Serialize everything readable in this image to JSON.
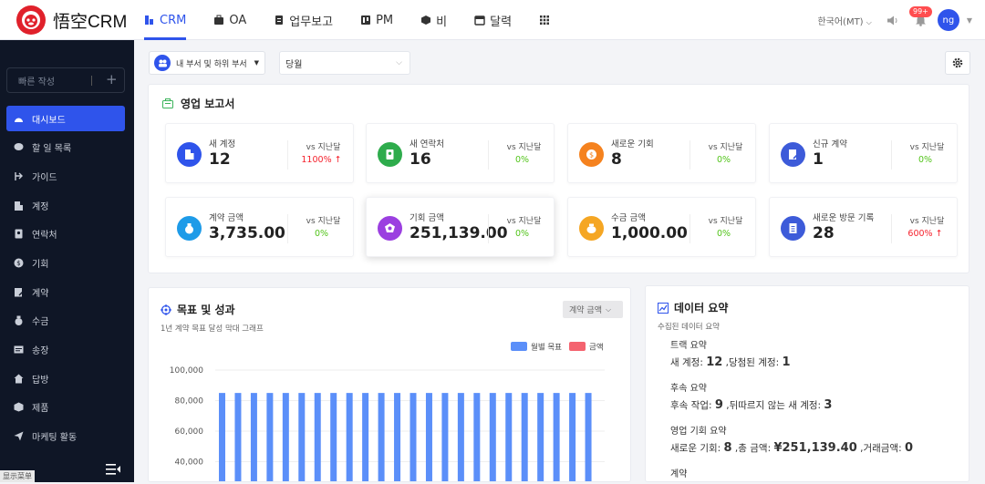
{
  "brand": {
    "name": "悟空CRM"
  },
  "nav": {
    "items": [
      {
        "label": "CRM",
        "icon": "chart-icon",
        "active": true
      },
      {
        "label": "OA",
        "icon": "briefcase-icon"
      },
      {
        "label": "업무보고",
        "icon": "report-icon"
      },
      {
        "label": "PM",
        "icon": "kanban-icon"
      },
      {
        "label": "비",
        "icon": "cube-icon"
      },
      {
        "label": "달력",
        "icon": "calendar-icon"
      }
    ],
    "language": "한국어(MT)",
    "notification_badge": "99+",
    "user_initials": "ng"
  },
  "sidebar": {
    "quick_create": "빠른 작성",
    "items": [
      {
        "label": "대시보드",
        "icon": "dashboard-icon",
        "active": true
      },
      {
        "label": "할 일 목록",
        "icon": "chat-icon"
      },
      {
        "label": "가이드",
        "icon": "guide-icon"
      },
      {
        "label": "계정",
        "icon": "building-icon"
      },
      {
        "label": "연락처",
        "icon": "contact-icon"
      },
      {
        "label": "기회",
        "icon": "coin-icon"
      },
      {
        "label": "계약",
        "icon": "contract-icon"
      },
      {
        "label": "수금",
        "icon": "moneybag-icon"
      },
      {
        "label": "송장",
        "icon": "invoice-icon"
      },
      {
        "label": "답방",
        "icon": "home-icon"
      },
      {
        "label": "제품",
        "icon": "box-icon"
      },
      {
        "label": "마케팅 활동",
        "icon": "send-icon"
      }
    ],
    "footer_tag": "显示菜单"
  },
  "filters": {
    "department": "내 부서 및 하위 부서",
    "period": "당월"
  },
  "sales_report": {
    "title": "영업 보고서",
    "compare_label": "vs 지난달",
    "stats": [
      {
        "label": "새 계정",
        "value": "12",
        "change": "1100%",
        "trend": "up",
        "color": "#2f54eb",
        "icon": "building-icon"
      },
      {
        "label": "새 연락처",
        "value": "16",
        "change": "0%",
        "trend": "flat",
        "color": "#2eac4c",
        "icon": "contact-icon"
      },
      {
        "label": "새로운 기회",
        "value": "8",
        "change": "0%",
        "trend": "flat",
        "color": "#f5821f",
        "icon": "coin-icon"
      },
      {
        "label": "신규 계약",
        "value": "1",
        "change": "0%",
        "trend": "flat",
        "color": "#3d5bd9",
        "icon": "contract-icon"
      },
      {
        "label": "계약 금액",
        "value": "3,735.00",
        "change": "0%",
        "trend": "flat",
        "color": "#1e9be8",
        "icon": "moneybag-icon"
      },
      {
        "label": "기회 금액",
        "value": "251,139.00",
        "change": "0%",
        "trend": "flat",
        "color": "#9b3fe0",
        "icon": "gem-icon"
      },
      {
        "label": "수금 금액",
        "value": "1,000.00",
        "change": "0%",
        "trend": "flat",
        "color": "#f5a623",
        "icon": "wallet-icon"
      },
      {
        "label": "새로운 방문 기록",
        "value": "28",
        "change": "600%",
        "trend": "up",
        "color": "#3d5bd9",
        "icon": "record-icon"
      }
    ]
  },
  "goals": {
    "title": "목표 및 성과",
    "subtitle": "1년 계약 목표 달성 막대 그래프",
    "selector": "계약 금액"
  },
  "chart_data": {
    "type": "bar",
    "series": [
      {
        "name": "월별 목표",
        "color": "#5b8ff9",
        "values": [
          85000,
          85000,
          85000,
          85000,
          85000,
          85000,
          85000,
          85000,
          85000,
          85000,
          85000,
          85000,
          85000,
          85000,
          85000,
          85000,
          85000,
          85000,
          85000,
          85000,
          85000,
          85000,
          85000,
          85000
        ]
      },
      {
        "name": "금액",
        "color": "#f4636f",
        "values": []
      }
    ],
    "y_ticks": [
      "100,000",
      "80,000",
      "60,000",
      "40,000"
    ],
    "ylim": [
      20000,
      100000
    ]
  },
  "data_summary": {
    "title": "데이터 요약",
    "subtitle": "수집된 데이터 요약",
    "blocks": [
      {
        "title": "트랙 요약",
        "parts": [
          {
            "label": "새 계정:",
            "value": "12"
          },
          {
            "label": ",당첨된 계정:",
            "value": "1"
          }
        ]
      },
      {
        "title": "후속 요약",
        "parts": [
          {
            "label": "후속 작업:",
            "value": "9"
          },
          {
            "label": ",뒤따르지 않는 새 계정:",
            "value": "3"
          }
        ]
      },
      {
        "title": "영업 기회 요약",
        "parts": [
          {
            "label": "새로운 기회:",
            "value": "8"
          },
          {
            "label": ",총 금액:",
            "value": "¥251,139.40"
          },
          {
            "label": ",거래금액:",
            "value": "0"
          }
        ]
      },
      {
        "title": "계약",
        "parts": []
      }
    ]
  }
}
